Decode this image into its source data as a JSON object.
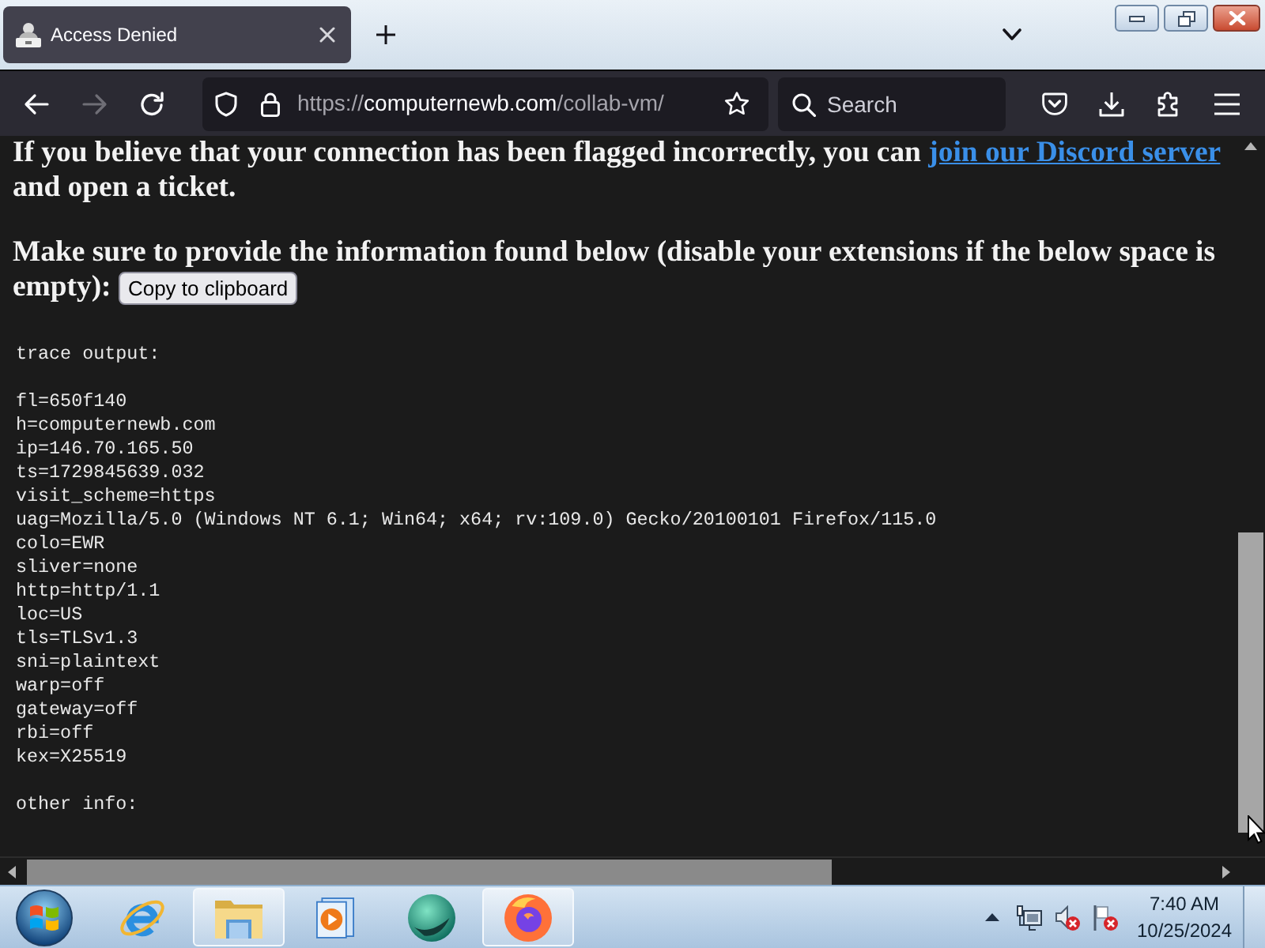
{
  "browser": {
    "tabs": [
      {
        "title": "Access Denied",
        "selected": true
      }
    ],
    "nav_buttons": [
      {
        "kind": "back",
        "disabled": false
      },
      {
        "kind": "forward",
        "disabled": true
      },
      {
        "kind": "reload",
        "disabled": false
      }
    ],
    "address_bar": {
      "scheme": "https://",
      "host": "computernewb.com",
      "path": "/collab-vm/"
    },
    "search": {
      "placeholder": "Search"
    }
  },
  "page": {
    "notice": {
      "text": "If you believe that your connection has been flagged incorrectly, you can",
      "link": "join our Discord server",
      "text_after": "and open a ticket."
    },
    "instruction": "Make sure to provide the information found below (disable your extensions if the below space is empty):",
    "copy_button": "Copy to clipboard",
    "sections": [
      {
        "heading": "trace output:",
        "lines": [
          "fl=650f140",
          "h=computernewb.com",
          "ip=146.70.165.50",
          "ts=1729845639.032",
          "visit_scheme=https",
          "uag=Mozilla/5.0 (Windows NT 6.1; Win64; x64; rv:109.0) Gecko/20100101 Firefox/115.0",
          "colo=EWR",
          "sliver=none",
          "http=http/1.1",
          "loc=US",
          "tls=TLSv1.3",
          "sni=plaintext",
          "warp=off",
          "gateway=off",
          "rbi=off",
          "kex=X25519"
        ]
      },
      {
        "heading": "other info:"
      }
    ]
  },
  "taskbar": {
    "apps": [
      {
        "kind": "e-browser",
        "open": false
      },
      {
        "kind": "folder",
        "open": true
      },
      {
        "kind": "media-player",
        "open": false
      },
      {
        "kind": "sphere",
        "open": false
      },
      {
        "kind": "fox-browser",
        "open": true
      }
    ],
    "clock": {
      "time": "7:40 AM",
      "date": "10/25/2024"
    }
  }
}
